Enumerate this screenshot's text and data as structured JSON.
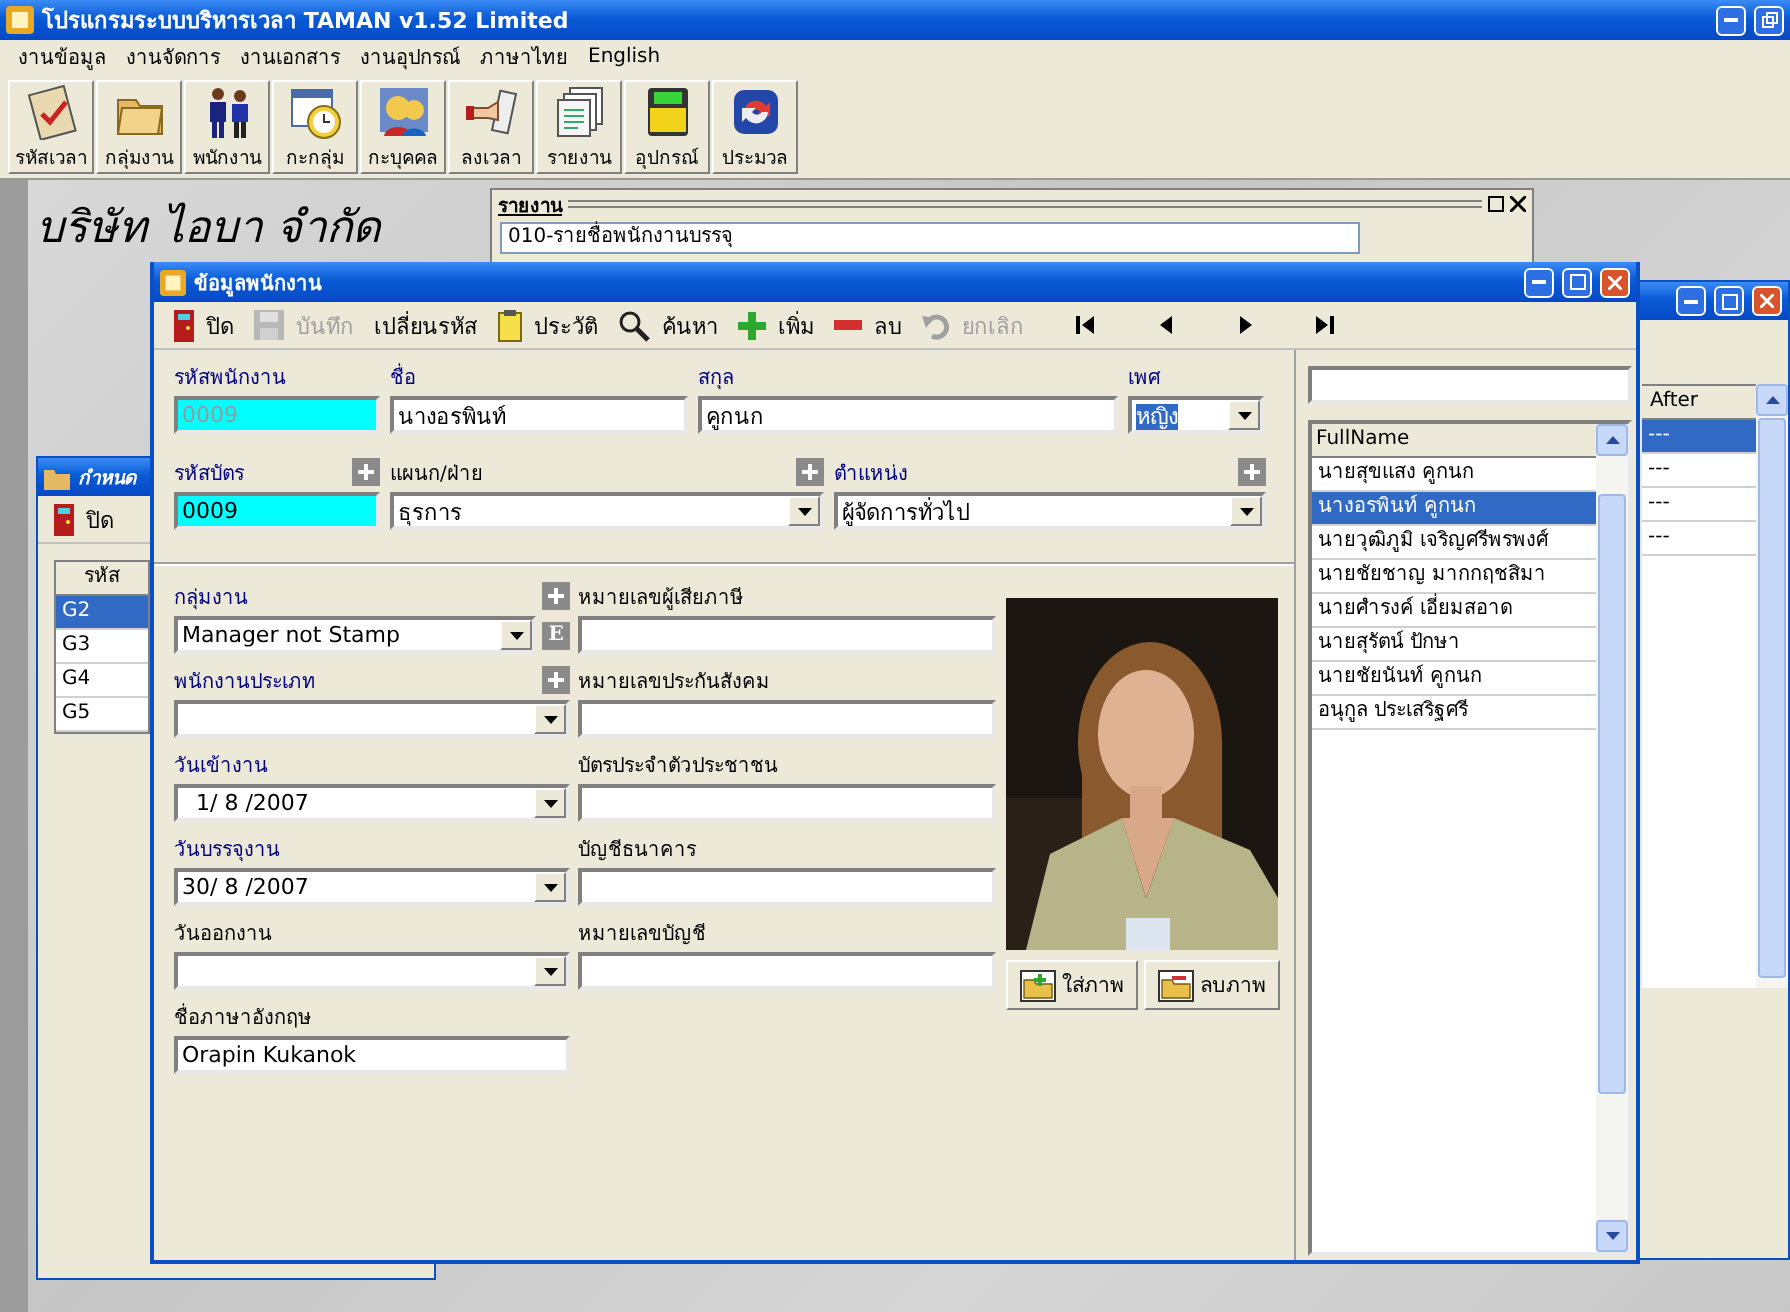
{
  "window": {
    "title": "โปรแกรมระบบบริหารเวลา TAMAN v1.52 Limited"
  },
  "menu": [
    "งานข้อมูล",
    "งานจัดการ",
    "งานเอกสาร",
    "งานอุปกรณ์",
    "ภาษาไทย",
    "English"
  ],
  "toolbar": [
    "รหัสเวลา",
    "กลุ่มงาน",
    "พนักงาน",
    "กะกลุ่ม",
    "กะบุคคล",
    "ลงเวลา",
    "รายงาน",
    "อุปกรณ์",
    "ประมวล"
  ],
  "company": "บริษัท ไอบา จำกัด",
  "report_window": {
    "title": "รายงาน",
    "selected_report": "010-รายชื่อพนักงานบรรจุ"
  },
  "group_window": {
    "title": "กำหนด",
    "close_button": "ปิด",
    "column": "รหัส",
    "rows": [
      {
        "code": "G2",
        "selected": true
      },
      {
        "code": "G3",
        "selected": false
      },
      {
        "code": "G4",
        "selected": false
      },
      {
        "code": "G5",
        "selected": false
      }
    ]
  },
  "side_window": {
    "column": "After",
    "rows": [
      {
        "value": "---",
        "selected": true
      },
      {
        "value": "---",
        "selected": false
      },
      {
        "value": "---",
        "selected": false
      },
      {
        "value": "---",
        "selected": false
      }
    ]
  },
  "dialog": {
    "title": "ข้อมูลพนักงาน",
    "toolbar": [
      {
        "kind": "door",
        "label": "ปิด",
        "disabled": false
      },
      {
        "kind": "save",
        "label": "บันทึก",
        "disabled": true
      },
      {
        "kind": "plain",
        "label": "เปลี่ยนรหัส",
        "disabled": false
      },
      {
        "kind": "notes",
        "label": "ประวัติ",
        "disabled": false
      },
      {
        "kind": "search",
        "label": "ค้นหา",
        "disabled": false
      },
      {
        "kind": "add",
        "label": "เพิ่ม",
        "disabled": false
      },
      {
        "kind": "remove",
        "label": "ลบ",
        "disabled": false
      },
      {
        "kind": "undo",
        "label": "ยกเลิก",
        "disabled": true
      }
    ],
    "top_rows": [
      [
        {
          "label": "รหัสพนักงาน",
          "kind": "text",
          "value": "0009",
          "color": "#000080",
          "highlighted": true,
          "disabled": true,
          "add": false,
          "value_selected": false
        },
        {
          "label": "ชื่อ",
          "kind": "text",
          "value": "นางอรพินท์",
          "color": "#000080",
          "highlighted": false,
          "disabled": false,
          "add": false,
          "value_selected": false
        },
        {
          "label": "สกุล",
          "kind": "text",
          "value": "คูกนก",
          "color": "#000080",
          "highlighted": false,
          "disabled": false,
          "add": false,
          "value_selected": false
        },
        {
          "label": "เพศ",
          "kind": "combo",
          "value": "หญิง",
          "color": "#000080",
          "highlighted": false,
          "disabled": false,
          "add": false,
          "value_selected": true
        }
      ],
      [
        {
          "label": "รหัสบัตร",
          "kind": "text",
          "value": "0009",
          "color": "#000080",
          "highlighted": true,
          "disabled": false,
          "add": true,
          "value_selected": false
        },
        {
          "label": "แผนก/ฝ่าย",
          "kind": "combo",
          "value": "ธุรการ",
          "color": "#000000",
          "highlighted": false,
          "disabled": false,
          "add": true,
          "value_selected": false
        },
        {
          "label": "ตำแหน่ง",
          "kind": "combo",
          "value": "ผู้จัดการทั่วไป",
          "color": "#000080",
          "highlighted": false,
          "disabled": false,
          "add": true,
          "value_selected": false
        }
      ]
    ],
    "left_fields": [
      {
        "label": "กลุ่มงาน",
        "kind": "combo",
        "value": "Manager not Stamp",
        "color": "#000080",
        "add": true,
        "extra_button": "E"
      },
      {
        "label": "พนักงานประเภท",
        "kind": "combo",
        "color": "#000080",
        "add": true
      },
      {
        "label": "วันเข้างาน",
        "kind": "combo",
        "value": "  1/ 8 /2007",
        "color": "#000080",
        "add": false
      },
      {
        "label": "วันบรรจุงาน",
        "kind": "combo",
        "value": "30/ 8 /2007",
        "color": "#000080",
        "add": false
      },
      {
        "label": "วันออกงาน",
        "kind": "combo",
        "color": "#000000",
        "add": false
      },
      {
        "label": "ชื่อภาษาอังกฤษ",
        "kind": "text",
        "value": "Orapin Kukanok",
        "color": "#000000",
        "add": false
      }
    ],
    "right_fields": [
      {
        "label": "หมายเลขผู้เสียภาษี"
      },
      {
        "label": "หมายเลขประกันสังคม"
      },
      {
        "label": "บัตรประจำตัวประชาชน"
      },
      {
        "label": "บัญชีธนาคาร"
      },
      {
        "label": "หมายเลขบัญชี"
      }
    ],
    "photo_buttons": [
      {
        "kind": "insert",
        "label": "ใส่ภาพ"
      },
      {
        "kind": "delete",
        "label": "ลบภาพ"
      }
    ],
    "name_list": {
      "column": "FullName",
      "rows": [
        {
          "name": "นายสุขแสง คูกนก",
          "selected": false
        },
        {
          "name": "นางอรพินท์ คูกนก",
          "selected": true
        },
        {
          "name": "นายวุฒิภูมิ เจริญศรีพรพงศ์",
          "selected": false
        },
        {
          "name": "นายชัยชาญ มากกฤชสิมา",
          "selected": false
        },
        {
          "name": "นายศำรงค์ เอี่ยมสอาด",
          "selected": false
        },
        {
          "name": "นายสุรัตน์ ปักษา",
          "selected": false
        },
        {
          "name": "นายชัยนันท์ คูกนก",
          "selected": false
        },
        {
          "name": "อนุกูล ประเสริฐศรี",
          "selected": false
        }
      ]
    }
  }
}
